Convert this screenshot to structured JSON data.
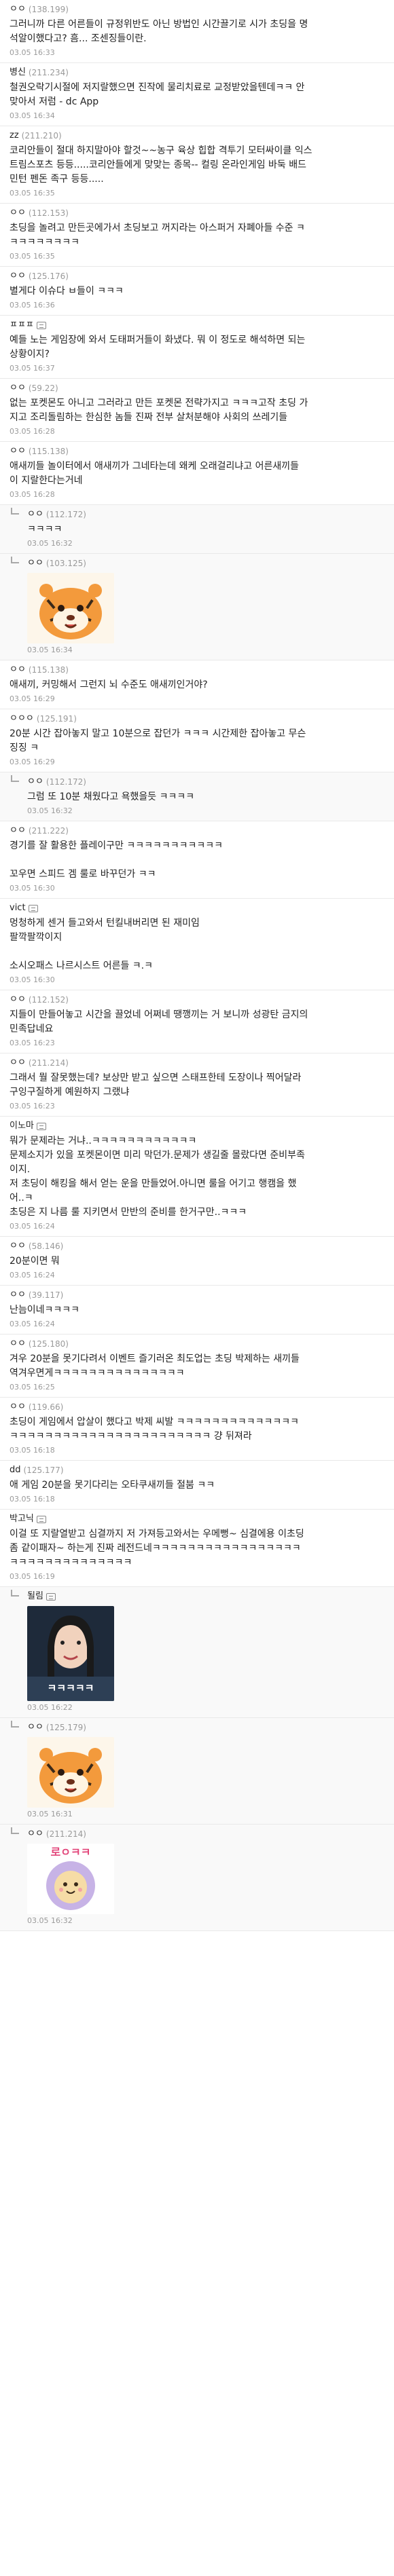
{
  "comments": [
    {
      "nick": "ㅇㅇ",
      "ip": "(138.199)",
      "lines": [
        "그러니까 다른 어른들이 규정위반도 아닌 방법인 시간끌기로 시가 초딩을 명",
        "석알이했다고? 흠... 조센징들이란."
      ],
      "time": "03.05 16:33"
    },
    {
      "nick": "병신",
      "ip": "(211.234)",
      "lines": [
        "철권오락기시절에 저지랄했으면 진작에 물리치료로 교정받았을텐데ㅋㅋ 안",
        "맞아서 저럼 - dc App"
      ],
      "time": "03.05 16:34"
    },
    {
      "nick": "zz",
      "ip": "(211.210)",
      "lines": [
        "코리안들이 절대 하지말아야 할것~~농구 육상 힙합 격투기 모터싸이클 익스",
        "트림스포츠 등등.....코리안들에게 맞맞는 종목-- 컬링 온라인게임 바둑 배드",
        "민턴 펜돈 족구 등등....."
      ],
      "time": "03.05 16:35"
    },
    {
      "nick": "ㅇㅇ",
      "ip": "(112.153)",
      "lines": [
        "초딩을 놀려고 만든곳에가서 초딩보고 꺼지라는 아스퍼거 자폐아들 수준 ㅋ",
        "ㅋㅋㅋㅋㅋㅋㅋㅋ"
      ],
      "time": "03.05 16:35"
    },
    {
      "nick": "ㅇㅇ",
      "ip": "(125.176)",
      "lines": [
        "별게다 이슈다 ㅂ들이 ㅋㅋㅋ"
      ],
      "time": "03.05 16:36"
    },
    {
      "nick": "ㅍㅍㅍ",
      "ip": "",
      "badge": true,
      "lines": [
        "예들 노는 게임장에 와서 도태퍼거들이 화냈다. 뭐 이 정도로 해석하면 되는",
        "상황이지?"
      ],
      "time": "03.05 16:37"
    },
    {
      "nick": "ㅇㅇ",
      "ip": "(59.22)",
      "lines": [
        "없는 포켓몬도 아니고 그러라고 만든 포켓몬 전략가지고 ㅋㅋㅋ고작 초딩 가",
        "지고 조리돌림하는 한심한 놈들 진짜 전부 살처분해야 사회의 쓰레기들"
      ],
      "time": "03.05 16:28"
    },
    {
      "nick": "ㅇㅇ",
      "ip": "(115.138)",
      "lines": [
        "애새끼들 놀이터에서 애새끼가 그네타는데 왜케 오래걸리냐고 어른새끼들",
        "이 지랄한다는거네"
      ],
      "time": "03.05 16:28"
    },
    {
      "nick": "ㅇㅇ",
      "ip": "(112.172)",
      "reply": true,
      "lines": [
        "ㅋㅋㅋㅋ"
      ],
      "time": "03.05 16:32"
    },
    {
      "nick": "ㅇㅇ",
      "ip": "(103.125)",
      "reply": true,
      "media": "tiger",
      "lines": [],
      "time": "03.05 16:34"
    },
    {
      "nick": "ㅇㅇ",
      "ip": "(115.138)",
      "lines": [
        "애새끼, 커밍해서 그런지 뇌 수준도 애새끼인거야?"
      ],
      "time": "03.05 16:29"
    },
    {
      "nick": "ㅇㅇㅇ",
      "ip": "(125.191)",
      "lines": [
        "20분 시간 잡아놓지 말고 10분으로 잡던가 ㅋㅋㅋ 시간제한 잡아놓고 무슨",
        "징징 ㅋ"
      ],
      "time": "03.05 16:29"
    },
    {
      "nick": "ㅇㅇ",
      "ip": "(112.172)",
      "reply": true,
      "lines": [
        "그럼 또 10분 채웠다고 욕했을듯 ㅋㅋㅋㅋ"
      ],
      "time": "03.05 16:32"
    },
    {
      "nick": "ㅇㅇ",
      "ip": "(211.222)",
      "lines": [
        "경기를 잘 활용한 플레이구만 ㅋㅋㅋㅋㅋㅋㅋㅋㅋㅋㅋ",
        "",
        "꼬우면 스피드 겜 룰로 바꾸던가 ㅋㅋ"
      ],
      "time": "03.05 16:30"
    },
    {
      "nick": "vict",
      "ip": "",
      "badge": true,
      "lines": [
        "멍청하게 센거 들고와서 턴킬내버리면 된 재미임",
        "팔깍팔깍이지",
        "",
        "소시오패스 나르시스트 어른들 ㅋ.ㅋ"
      ],
      "time": "03.05 16:30"
    },
    {
      "nick": "ㅇㅇ",
      "ip": "(112.152)",
      "lines": [
        "지들이 만들어놓고 시간을 끌었네 어쩌네 땡깽끼는 거 보니까 성광탄 금지의",
        "민족답네요"
      ],
      "time": "03.05 16:23"
    },
    {
      "nick": "ㅇㅇ",
      "ip": "(211.214)",
      "lines": [
        "그래서 뭘 잘못했는데? 보상만 받고 싶으면 스태프한테 도장이나 찍어달라",
        "구잉구질하게 예원하지 그랬냐"
      ],
      "time": "03.05 16:23"
    },
    {
      "nick": "이노마",
      "ip": "",
      "badge": true,
      "lines": [
        "뭐가 문제라는 거냐..ㅋㅋㅋㅋㅋㅋㅋㅋㅋㅋㅋㅋ",
        "문제소지가 있을 포켓몬이면 미리 막던가.문제가 생길줄 몰랐다면 준비부족",
        "이지.",
        "저 초딩이 해킹을 해서 얻는 운을 만들었어.아니면 룰을 어기고 행캠을 했",
        "어..ㅋ",
        "초딩은 지 나름 룰 지키면서 만반의 준비를 한거구만..ㅋㅋㅋ"
      ],
      "time": "03.05 16:24"
    },
    {
      "nick": "ㅇㅇ",
      "ip": "(58.146)",
      "lines": [
        "20분이면 뭐"
      ],
      "time": "03.05 16:24"
    },
    {
      "nick": "ㅇㅇ",
      "ip": "(39.117)",
      "lines": [
        "난늠이네ㅋㅋㅋㅋ"
      ],
      "time": "03.05 16:24"
    },
    {
      "nick": "ㅇㅇ",
      "ip": "(125.180)",
      "lines": [
        "겨우 20분을 못기다려서 이벤트 즐기러온 최도업는 초딩 박제하는 새끼들",
        "역겨우면게ㅋㅋㅋㅋㅋㅋㅋㅋㅋㅋㅋㅋㅋㅋㅋ"
      ],
      "time": "03.05 16:25"
    },
    {
      "nick": "ㅇㅇ",
      "ip": "(119.66)",
      "lines": [
        "초딩이 게임에서 압살이 했다고 박제 씨발 ㅋㅋㅋㅋㅋㅋㅋㅋㅋㅋㅋㅋㅋㅋ",
        "ㅋㅋㅋㅋㅋㅋㅋㅋㅋㅋㅋㅋㅋㅋㅋㅋㅋㅋㅋㅋㅋㅋㅋ 걍 뒤져라"
      ],
      "time": "03.05 16:18"
    },
    {
      "nick": "dd",
      "ip": "(125.177)",
      "lines": [
        "애 게임 20분을 못기다리는 오타쿠새끼들 절붐 ㅋㅋ"
      ],
      "time": "03.05 16:18"
    },
    {
      "nick": "박고닉",
      "ip": "",
      "badge": true,
      "lines": [
        "이걸 또 지랄열받고 심결까지 저 가져등고와서는 우메뻥~ 심결에용 이초딩",
        "좀 같이패자~ 하는게 진짜 레전드네ㅋㅋㅋㅋㅋㅋㅋㅋㅋㅋㅋㅋㅋㅋㅋㅋㅋ",
        "ㅋㅋㅋㅋㅋㅋㅋㅋㅋㅋㅋㅋㅋㅋ"
      ],
      "time": "03.05 16:19"
    },
    {
      "nick": "될림",
      "ip": "",
      "badge": true,
      "reply": true,
      "media": "photo",
      "lines": [],
      "time": "03.05 16:22"
    },
    {
      "nick": "ㅇㅇ",
      "ip": "(125.179)",
      "reply": true,
      "media": "tiger",
      "lines": [],
      "time": "03.05 16:31"
    },
    {
      "nick": "ㅇㅇ",
      "ip": "(211.214)",
      "reply": true,
      "media": "lion",
      "lines": [],
      "time": "03.05 16:32"
    }
  ],
  "stickers": {
    "photo_caption": "ㅋㅋㅋㅋㅋ",
    "lion_caption": "로ㅇㅋㅋ"
  },
  "colors": {
    "ip": "#999999",
    "time": "#9a9a9a",
    "divider": "#e9e9e9"
  }
}
